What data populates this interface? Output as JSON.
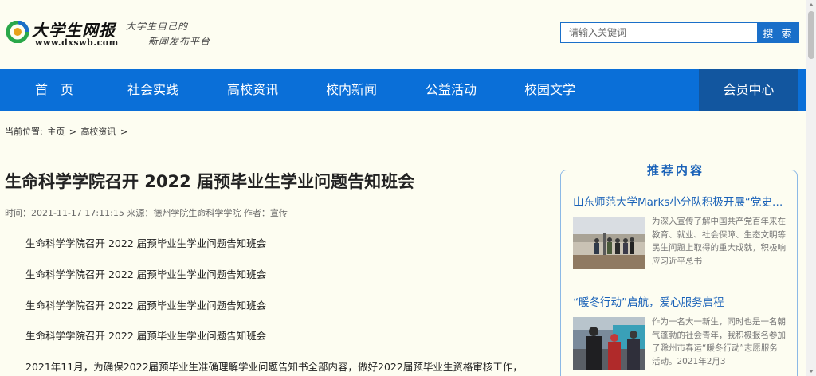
{
  "header": {
    "logo_title": "大学生网报",
    "logo_url": "www.dxswb.com",
    "slogan_line1": "大学生自己的",
    "slogan_line2": "新闻发布平台",
    "search_placeholder": "请输入关键词",
    "search_button": "搜 索"
  },
  "nav": {
    "items": [
      "首　页",
      "社会实践",
      "高校资讯",
      "校内新闻",
      "公益活动",
      "校园文学"
    ],
    "member": "会员中心"
  },
  "breadcrumb": {
    "prefix": "当前位置:",
    "home": "主页",
    "sep1": ">",
    "section": "高校资讯",
    "sep2": ">"
  },
  "article": {
    "title": "生命科学学院召开 2022 届预毕业生学业问题告知班会",
    "meta": "时间：2021-11-17 17:11:15 来源：德州学院生命科学学院 作者：宣传",
    "paragraphs": [
      "生命科学学院召开 2022 届预毕业生学业问题告知班会",
      "生命科学学院召开 2022 届预毕业生学业问题告知班会",
      "生命科学学院召开 2022 届预毕业生学业问题告知班会",
      "生命科学学院召开 2022 届预毕业生学业问题告知班会",
      "2021年11月，为确保2022届预毕业生准确理解学业问题告知书全部内容，做好2022届预毕业生资格审核工作，"
    ]
  },
  "sidebar": {
    "title": "推荐内容",
    "items": [
      {
        "title": "山东师范大学Marks小分队积极开展“党史学习教育”",
        "desc": "为深入宣传了解中国共产党百年来在教育、就业、社会保障、生态文明等民生问题上取得的重大成就，积极响应习近平总书"
      },
      {
        "title": "“暖冬行动”启航，爱心服务启程",
        "desc": "作为一名大一新生，同时也是一名朝气蓬勃的社会青年，我积极报名参加了滁州市春运“暖冬行动”志愿服务活动。2021年2月3"
      }
    ]
  },
  "colors": {
    "nav_blue": "#0a6fd8",
    "member_blue": "#12569f",
    "link_blue": "#1a62b8",
    "background": "#fdfdf1"
  }
}
